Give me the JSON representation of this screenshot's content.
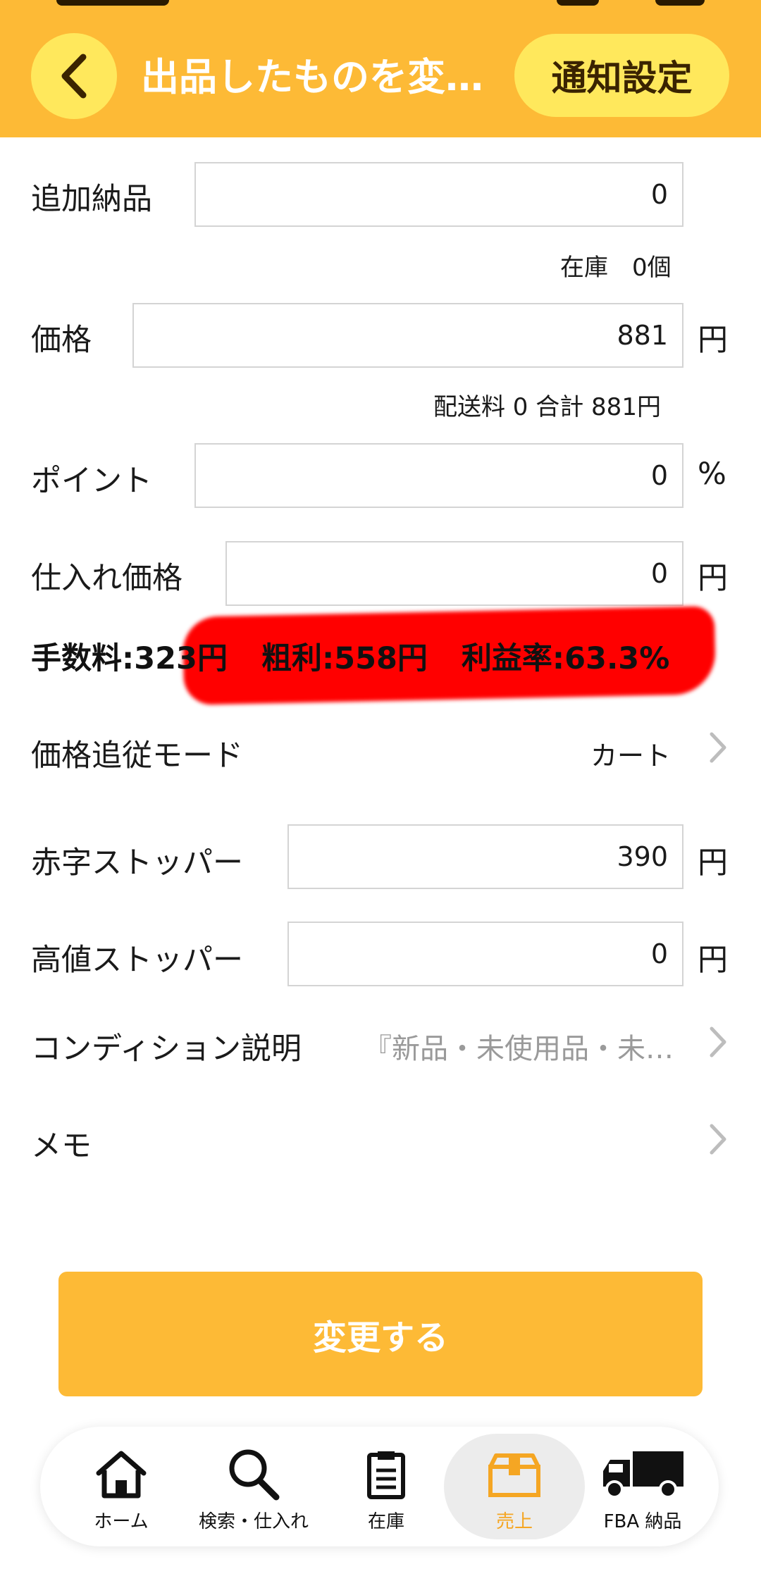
{
  "header": {
    "title": "出品したものを変…",
    "notify_label": "通知設定"
  },
  "form": {
    "additional_stock_label": "追加納品",
    "additional_stock_value": "0",
    "stock_note": "在庫　0個",
    "price_label": "価格",
    "price_value": "881",
    "price_unit": "円",
    "price_note": "配送料 0  合計 881円",
    "point_label": "ポイント",
    "point_value": "0",
    "point_unit": "%",
    "purchase_price_label": "仕入れ価格",
    "purchase_price_value": "0",
    "purchase_price_unit": "円",
    "fee_text": "手数料:323円",
    "gross_profit_text": "粗利:558円",
    "profit_rate_text": "利益率:63.3%",
    "follow_mode_label": "価格追従モード",
    "follow_mode_value": "カート",
    "deficit_stopper_label": "赤字ストッパー",
    "deficit_stopper_value": "390",
    "deficit_stopper_unit": "円",
    "high_stopper_label": "高値ストッパー",
    "high_stopper_value": "0",
    "high_stopper_unit": "円",
    "condition_label": "コンディション説明",
    "condition_value": "『新品・未使用品・未…",
    "memo_label": "メモ"
  },
  "submit_label": "変更する",
  "tabs": [
    {
      "label": "ホーム",
      "icon": "home-icon",
      "active": false
    },
    {
      "label": "検索・仕入れ",
      "icon": "search-icon",
      "active": false
    },
    {
      "label": "在庫",
      "icon": "clipboard-icon",
      "active": false
    },
    {
      "label": "売上",
      "icon": "box-icon",
      "active": true
    },
    {
      "label": "FBA 納品",
      "icon": "truck-icon",
      "active": false
    }
  ],
  "colors": {
    "accent": "#FDBA36",
    "button_yellow": "#FFE85C",
    "redaction": "#FF0000",
    "active_tab": "#F5A623"
  }
}
